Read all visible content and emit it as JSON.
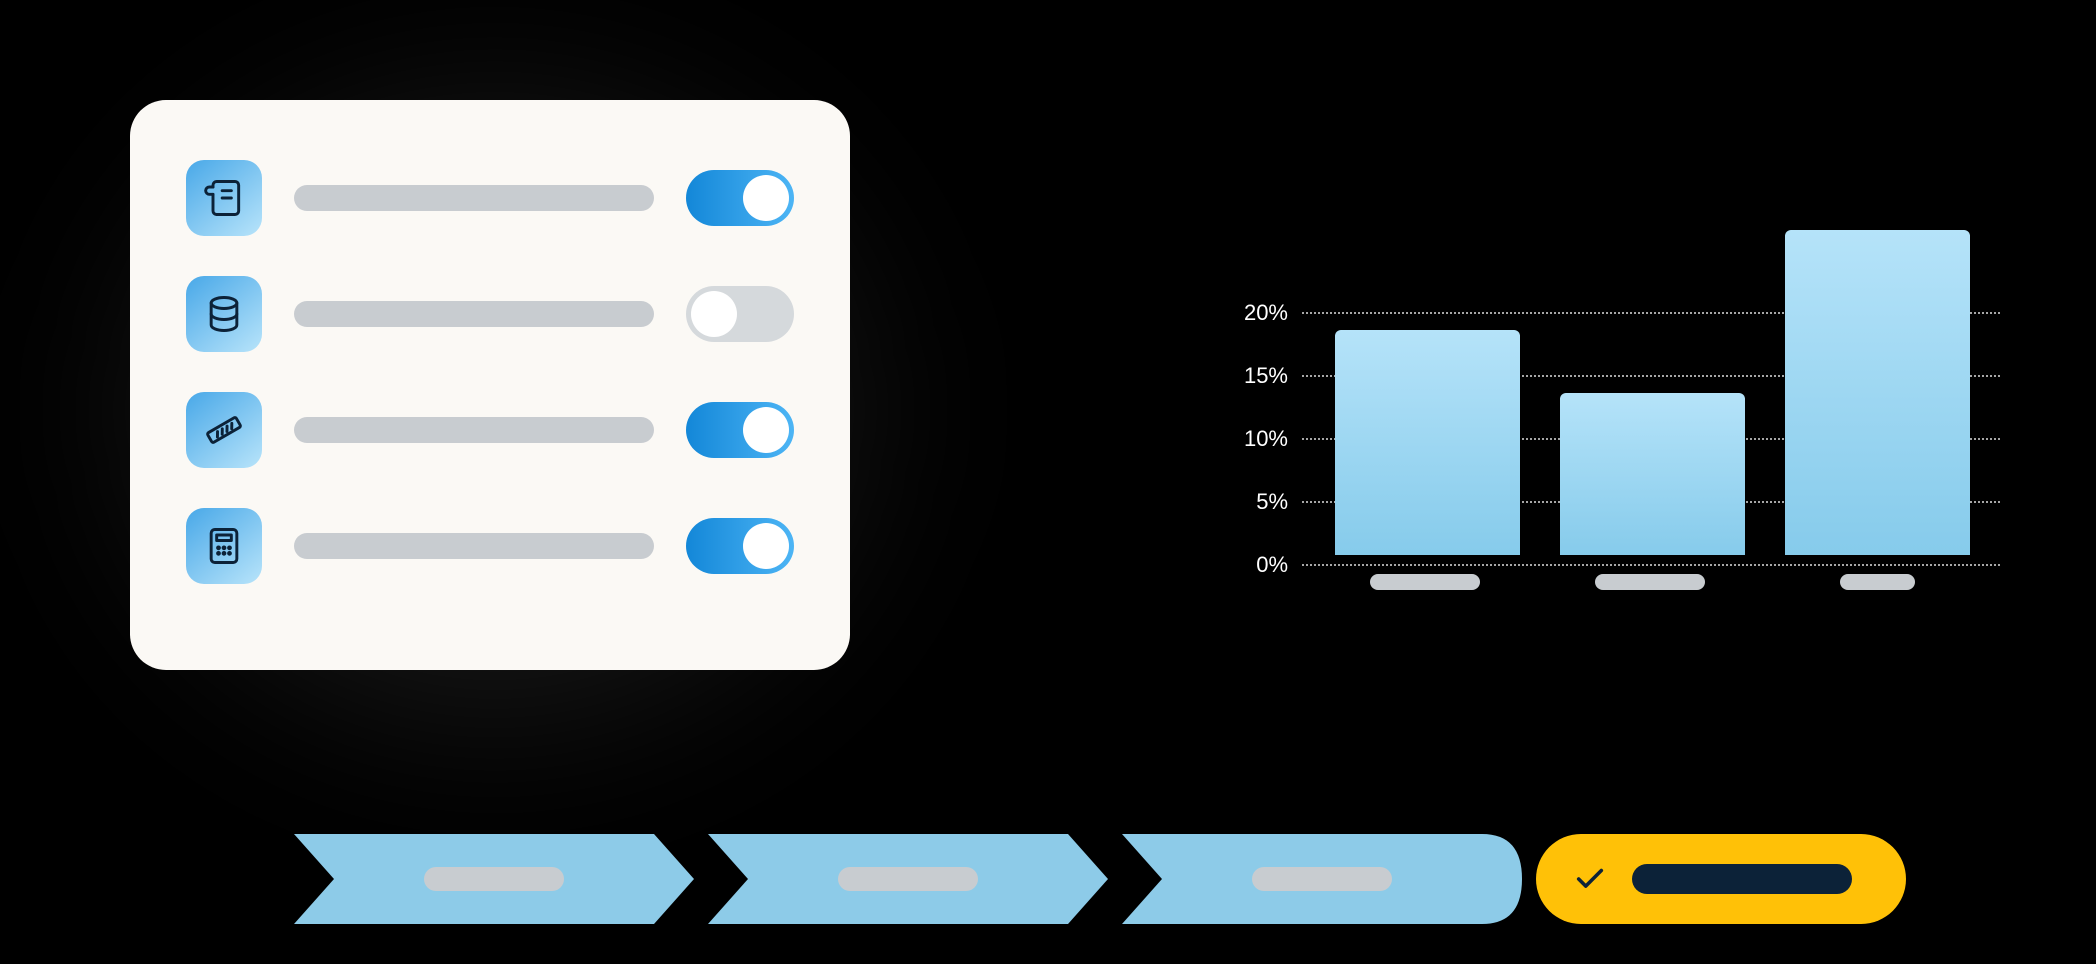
{
  "settings": [
    {
      "icon": "scroll-icon",
      "enabled": true
    },
    {
      "icon": "database-icon",
      "enabled": false
    },
    {
      "icon": "ruler-icon",
      "enabled": true
    },
    {
      "icon": "calculator-icon",
      "enabled": true
    }
  ],
  "chart_data": {
    "type": "bar",
    "categories": [
      "",
      "",
      ""
    ],
    "values": [
      18,
      13,
      26
    ],
    "ylabel": "",
    "xlabel": "",
    "ylim": [
      0,
      20
    ],
    "ticks": [
      "20%",
      "15%",
      "10%",
      "5%",
      "0%"
    ]
  },
  "workflow": {
    "steps": 3,
    "final_completed": true
  },
  "colors": {
    "bar_gradient_top": "#B5E3F9",
    "bar_gradient_bottom": "#86CBEB",
    "chevron": "#8DCBE8",
    "final": "#FFC107",
    "toggle_on": "#2E9BE6"
  }
}
